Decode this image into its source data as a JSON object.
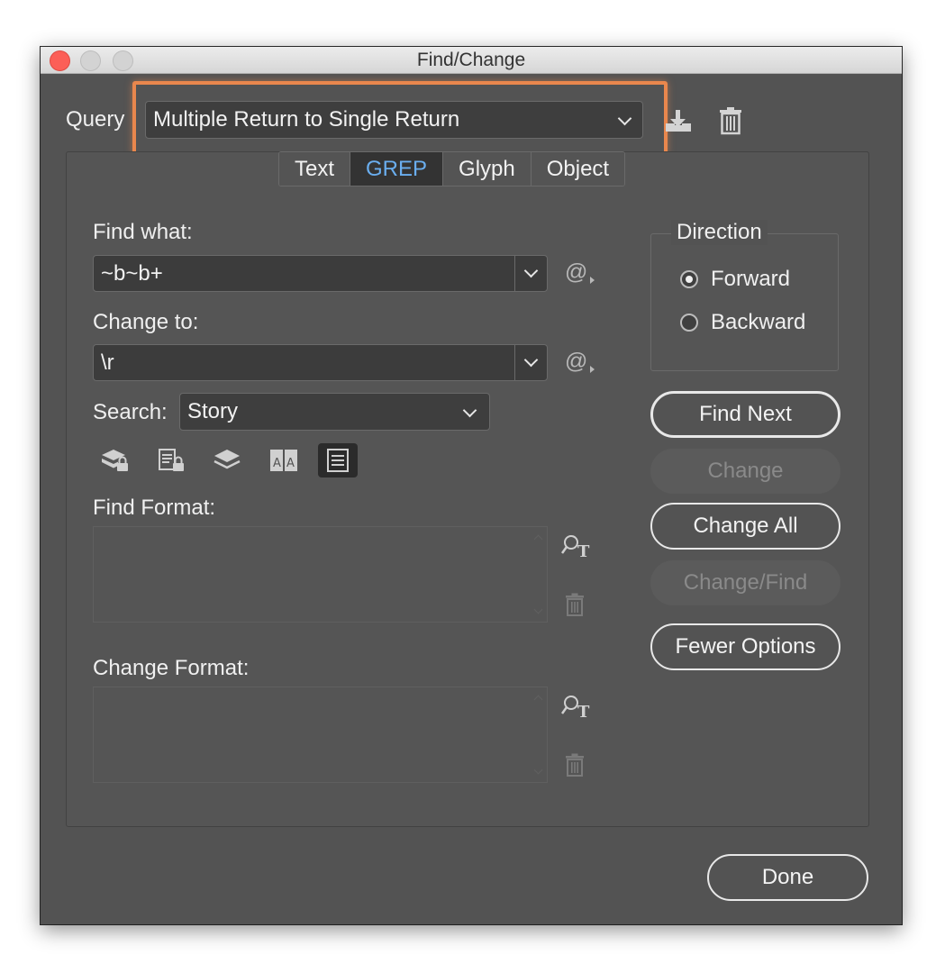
{
  "window": {
    "title": "Find/Change"
  },
  "query": {
    "label": "Query",
    "selected": "Multiple Return to Single Return"
  },
  "tabs": [
    {
      "label": "Text",
      "active": false
    },
    {
      "label": "GREP",
      "active": true
    },
    {
      "label": "Glyph",
      "active": false
    },
    {
      "label": "Object",
      "active": false
    }
  ],
  "find_what": {
    "label": "Find what:",
    "value": "~b~b+"
  },
  "change_to": {
    "label": "Change to:",
    "value": "\\r"
  },
  "search": {
    "label": "Search:",
    "selected": "Story"
  },
  "options_icons": [
    "locked-layers-icon",
    "locked-stories-icon",
    "hidden-layers-icon",
    "master-pages-icon",
    "footnotes-icon"
  ],
  "find_format": {
    "label": "Find Format:"
  },
  "change_format": {
    "label": "Change Format:"
  },
  "direction": {
    "title": "Direction",
    "options": [
      {
        "label": "Forward",
        "selected": true
      },
      {
        "label": "Backward",
        "selected": false
      }
    ]
  },
  "buttons": {
    "find_next": "Find Next",
    "change": "Change",
    "change_all": "Change All",
    "change_find": "Change/Find",
    "fewer_options": "Fewer Options",
    "done": "Done"
  },
  "colors": {
    "highlight": "#e9874d",
    "active_tab_text": "#6aaeef",
    "dialog_bg": "#535353"
  }
}
